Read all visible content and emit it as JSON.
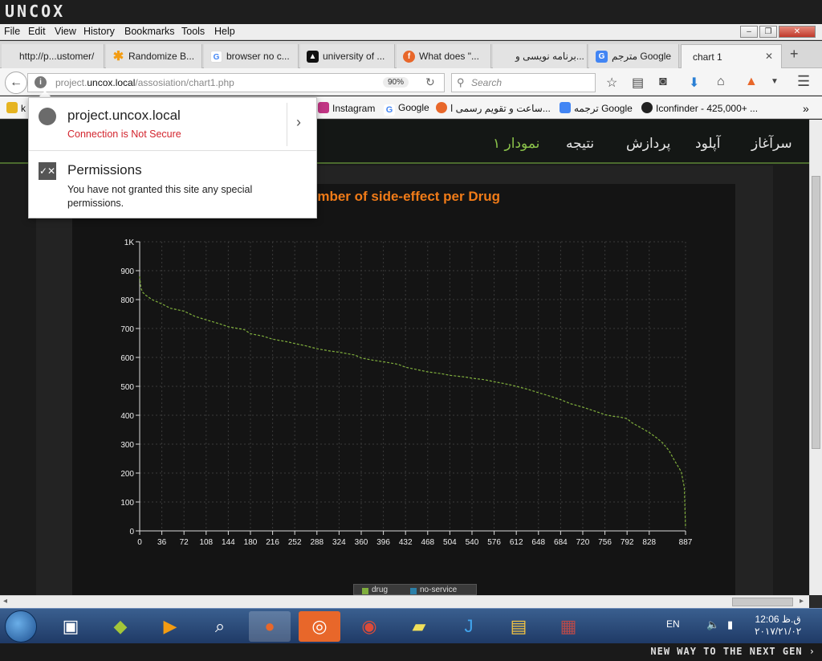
{
  "os": {
    "brand": "UNCOX",
    "tagline": "NEW WAY TO THE NEXT GEN ›"
  },
  "menu": [
    "File",
    "Edit",
    "View",
    "History",
    "Bookmarks",
    "Tools",
    "Help"
  ],
  "tabs": [
    {
      "label": "http://p...ustomer/",
      "icon": "page-icon",
      "color": "#777"
    },
    {
      "label": "Randomize B...",
      "icon": "asterisk-icon",
      "color": "#f39c12"
    },
    {
      "label": "browser no c...",
      "icon": "google-icon",
      "color": "#4285f4"
    },
    {
      "label": "university of ...",
      "icon": "university-icon",
      "color": "#111"
    },
    {
      "label": "What does \"...",
      "icon": "firefox-icon",
      "color": "#e8672a"
    },
    {
      "label": "برنامه نویسی و...",
      "icon": "page-icon",
      "color": "#eee"
    },
    {
      "label": "مترجم Google",
      "icon": "translate-icon",
      "color": "#4285f4"
    },
    {
      "label": "chart 1",
      "icon": "page-icon",
      "color": "#eee"
    }
  ],
  "nav": {
    "url_prefix": "project.",
    "url_host": "uncox.local",
    "url_path": "/assosiation/chart1.php",
    "zoom": "90%",
    "search_placeholder": "Search"
  },
  "bookmarks": [
    {
      "label": "k",
      "color": "#e6b422"
    },
    {
      "label": "Instagram",
      "color": "#c13584"
    },
    {
      "label": "Google",
      "color": "#4285f4"
    },
    {
      "label": "ساعت و تقویم رسمی ا...",
      "color": "#e8672a"
    },
    {
      "label": "ترجمه Google",
      "color": "#4285f4"
    },
    {
      "label": "Iconfinder - 425,000+ ...",
      "color": "#222"
    }
  ],
  "popup": {
    "host": "project.uncox.local",
    "warning": "Connection is Not Secure",
    "perm_title": "Permissions",
    "perm_text": "You have not granted this site any special permissions."
  },
  "site_nav": [
    {
      "label": "سرآغاز",
      "active": false
    },
    {
      "label": "آپلود",
      "active": false
    },
    {
      "label": "پردازش",
      "active": false
    },
    {
      "label": "نتیجه",
      "active": false
    },
    {
      "label": "نمودار ۱",
      "active": true
    }
  ],
  "chart_data": {
    "type": "line",
    "title": "umber of side-effect per Drug",
    "xlim": [
      0,
      887
    ],
    "ylim": [
      0,
      1000
    ],
    "x_ticks": [
      "0",
      "36",
      "72",
      "108",
      "144",
      "180",
      "216",
      "252",
      "288",
      "324",
      "360",
      "396",
      "432",
      "468",
      "504",
      "540",
      "576",
      "612",
      "648",
      "684",
      "720",
      "756",
      "792",
      "828",
      "887"
    ],
    "y_ticks": [
      "0",
      "100",
      "200",
      "300",
      "400",
      "500",
      "600",
      "700",
      "800",
      "900",
      "1K"
    ],
    "grid": true,
    "line_color": "#7fae3c",
    "series": [
      {
        "x": [
          0,
          2,
          5,
          10,
          20,
          36,
          50,
          72,
          90,
          108,
          130,
          144,
          170,
          180,
          200,
          216,
          240,
          252,
          270,
          288,
          310,
          324,
          350,
          360,
          380,
          396,
          420,
          432,
          450,
          468,
          490,
          504,
          530,
          540,
          560,
          576,
          600,
          612,
          630,
          648,
          670,
          684,
          700,
          720,
          740,
          756,
          770,
          780,
          792,
          800,
          815,
          828,
          840,
          850,
          860,
          870,
          880,
          885,
          887
        ],
        "y": [
          880,
          840,
          825,
          815,
          800,
          785,
          770,
          760,
          742,
          730,
          716,
          706,
          696,
          682,
          674,
          663,
          654,
          648,
          640,
          630,
          622,
          618,
          608,
          598,
          590,
          585,
          576,
          566,
          558,
          550,
          544,
          538,
          532,
          528,
          523,
          516,
          506,
          500,
          490,
          478,
          464,
          454,
          440,
          428,
          414,
          402,
          396,
          394,
          388,
          374,
          356,
          340,
          322,
          304,
          278,
          240,
          205,
          150,
          10
        ]
      }
    ]
  },
  "legend": [
    "drug",
    "no-service"
  ],
  "tray": {
    "lang": "EN",
    "time": "12:06 ق.ظ",
    "date": "۲۰۱۷/۲۱/۰۲"
  }
}
